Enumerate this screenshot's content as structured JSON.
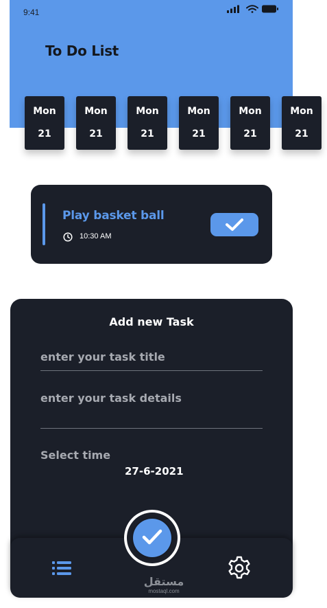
{
  "status_bar": {
    "time": "9:41",
    "icons": [
      "signal-icon",
      "wifi-icon",
      "battery-icon"
    ]
  },
  "header": {
    "title": "To Do List"
  },
  "days": [
    {
      "name": "Mon",
      "num": "21"
    },
    {
      "name": "Mon",
      "num": "21"
    },
    {
      "name": "Mon",
      "num": "21"
    },
    {
      "name": "Mon",
      "num": "21"
    },
    {
      "name": "Mon",
      "num": "21"
    },
    {
      "name": "Mon",
      "num": "21"
    }
  ],
  "task": {
    "title": "Play basket ball",
    "time": "10:30 AM",
    "icon": "clock-icon",
    "done_icon": "check-icon"
  },
  "form": {
    "title": "Add new Task",
    "title_placeholder": "enter your task title",
    "details_placeholder": "enter your task details",
    "select_time_label": "Select time",
    "date": "27-6-2021"
  },
  "nav": {
    "left_icon": "list-icon",
    "center_icon": "check-icon",
    "right_icon": "gear-icon"
  },
  "watermark": {
    "arabic": "مستقل",
    "latin": "mostaql.com"
  },
  "colors": {
    "accent": "#5b98ea",
    "dark": "#1b1f29",
    "muted": "#a6a9b0"
  }
}
